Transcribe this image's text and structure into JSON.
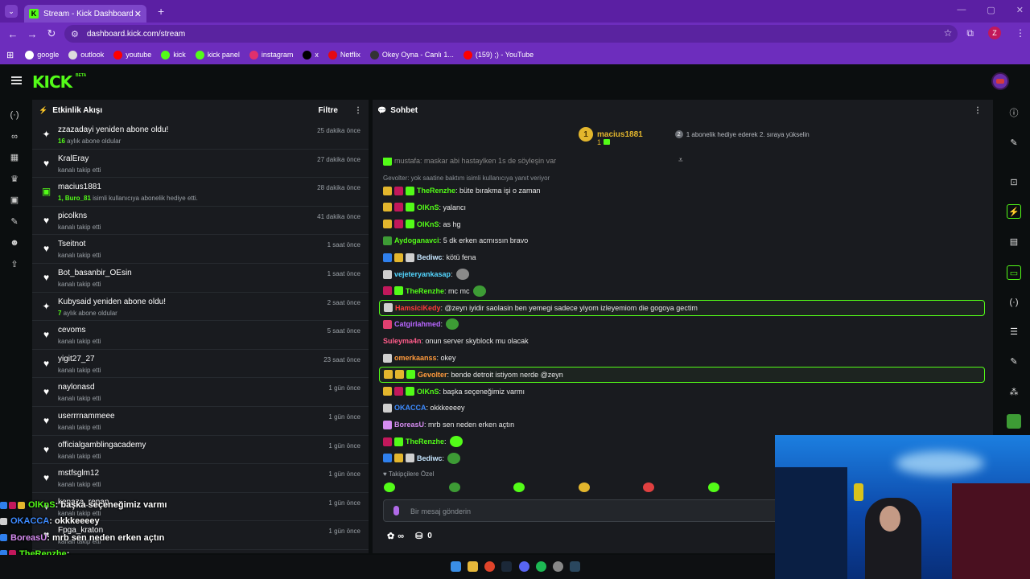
{
  "browser": {
    "tab_title": "Stream - Kick Dashboard",
    "url": "dashboard.kick.com/stream",
    "profile_initial": "Z",
    "bookmarks": [
      {
        "label": "google",
        "icon": "google-icon",
        "color": "#ffffff"
      },
      {
        "label": "outlook",
        "icon": "globe-icon",
        "color": "#dddddd"
      },
      {
        "label": "youtube",
        "icon": "youtube-icon",
        "color": "#ff0000"
      },
      {
        "label": "kick",
        "icon": "kick-icon",
        "color": "#53fc18"
      },
      {
        "label": "kick panel",
        "icon": "kick-icon",
        "color": "#53fc18"
      },
      {
        "label": "instagram",
        "icon": "instagram-icon",
        "color": "#e1306c"
      },
      {
        "label": "x",
        "icon": "x-icon",
        "color": "#000000"
      },
      {
        "label": "Netflix",
        "icon": "netflix-icon",
        "color": "#e50914"
      },
      {
        "label": "Okey Oyna - Canlı 1...",
        "icon": "okey-icon",
        "color": "#333333"
      },
      {
        "label": "(159) ;) - YouTube",
        "icon": "youtube-icon",
        "color": "#ff0000"
      }
    ]
  },
  "kick": {
    "logo": "KICK",
    "beta": "BETA"
  },
  "activity": {
    "title": "Etkinlik Akışı",
    "filter": "Filtre",
    "events": [
      {
        "icon": "sparkle-icon",
        "title": "zzazadayi yeniden abone oldu!",
        "hl": "16",
        "sub": " aylık abone oldular",
        "time": "25 dakika önce"
      },
      {
        "icon": "heart-icon",
        "title": "KralEray",
        "hl": "",
        "sub": "kanalı takip etti",
        "time": "27 dakika önce"
      },
      {
        "icon": "gift-icon",
        "title": "macius1881",
        "hl": "1, Buro_81",
        "sub": " isimli kullanıcıya abonelik hediye etti.",
        "time": "28 dakika önce"
      },
      {
        "icon": "heart-icon",
        "title": "picolkns",
        "hl": "",
        "sub": "kanalı takip etti",
        "time": "41 dakika önce"
      },
      {
        "icon": "heart-icon",
        "title": "Tseitnot",
        "hl": "",
        "sub": "kanalı takip etti",
        "time": "1 saat önce"
      },
      {
        "icon": "heart-icon",
        "title": "Bot_basanbir_OEsin",
        "hl": "",
        "sub": "kanalı takip etti",
        "time": "1 saat önce"
      },
      {
        "icon": "sparkle-icon",
        "title": "Kubysaid yeniden abone oldu!",
        "hl": "7",
        "sub": " aylık abone oldular",
        "time": "2 saat önce"
      },
      {
        "icon": "heart-icon",
        "title": "cevoms",
        "hl": "",
        "sub": "kanalı takip etti",
        "time": "5 saat önce"
      },
      {
        "icon": "heart-icon",
        "title": "yigit27_27",
        "hl": "",
        "sub": "kanalı takip etti",
        "time": "23 saat önce"
      },
      {
        "icon": "heart-icon",
        "title": "naylonasd",
        "hl": "",
        "sub": "kanalı takip etti",
        "time": "1 gün önce"
      },
      {
        "icon": "heart-icon",
        "title": "userrrnammeee",
        "hl": "",
        "sub": "kanalı takip etti",
        "time": "1 gün önce"
      },
      {
        "icon": "heart-icon",
        "title": "officialgamblingacademy",
        "hl": "",
        "sub": "kanalı takip etti",
        "time": "1 gün önce"
      },
      {
        "icon": "heart-icon",
        "title": "mstfsglm12",
        "hl": "",
        "sub": "kanalı takip etti",
        "time": "1 gün önce"
      },
      {
        "icon": "heart-icon",
        "title": "kenaza_renan",
        "hl": "",
        "sub": "kanalı takip etti",
        "time": "1 gün önce"
      },
      {
        "icon": "heart-icon",
        "title": "Fpga_kraton",
        "hl": "",
        "sub": "kanalı takip etti",
        "time": "1 gün önce"
      }
    ]
  },
  "chat": {
    "title": "Sohbet",
    "pinned": {
      "rank": "1",
      "name": "macius1881",
      "count": "1",
      "gift_rank": "2",
      "gift_text": "1 abonelik hediye ederek 2. sıraya yükselin"
    },
    "partial_top": "mustafa: maskar abi hastaylken 1s de söyleşin var",
    "reply": "Gevolter: yok saatine baktım isimli kullanıcıya yanıt veriyor",
    "messages": [
      {
        "badges": [
          "#e3b62d",
          "#c2185b",
          "#53fc18"
        ],
        "user": "TheRenzhe",
        "color": "#53fc18",
        "text": ": büte bırakma işi o zaman",
        "emote": "",
        "hl": false
      },
      {
        "badges": [
          "#e3b62d",
          "#c2185b",
          "#53fc18"
        ],
        "user": "OlKnS",
        "color": "#53fc18",
        "text": ": yalancı",
        "emote": "",
        "hl": false
      },
      {
        "badges": [
          "#e3b62d",
          "#c2185b",
          "#53fc18"
        ],
        "user": "OlKnS",
        "color": "#53fc18",
        "text": ": as hg",
        "emote": "",
        "hl": false
      },
      {
        "badges": [
          "#3d9b35"
        ],
        "user": "Aydoganavci",
        "color": "#53fc18",
        "text": ": 5 dk erken acmıssın bravo",
        "emote": "",
        "hl": false
      },
      {
        "badges": [
          "#2f80ed",
          "#e3b62d",
          "#cfcfcf"
        ],
        "user": "Bediwc",
        "color": "#c6e6ff",
        "text": ": kötü fena",
        "emote": "",
        "hl": false
      },
      {
        "badges": [
          "#cfcfcf"
        ],
        "user": "vejeteryankasap",
        "color": "#53d6ff",
        "text": ": ",
        "emote": "#8a8a8a",
        "hl": false
      },
      {
        "badges": [
          "#c2185b",
          "#53fc18"
        ],
        "user": "TheRenzhe",
        "color": "#53fc18",
        "text": ": mc mc",
        "emote": "#3d9b35",
        "hl": false
      },
      {
        "badges": [
          "#cfcfcf"
        ],
        "user": "HamsiciKedy",
        "color": "#ff3b3b",
        "text": ": @zeyn iyidir saolasin ben yemegi sadece yiyom izleyemiom die gogoya gectim",
        "emote": "",
        "hl": true
      },
      {
        "badges": [
          "#e04070"
        ],
        "user": "Catgirlahmed",
        "color": "#b866ff",
        "text": ": ",
        "emote": "#3d9b35",
        "hl": false
      },
      {
        "badges": [],
        "user": "Suleyma4n",
        "color": "#ff5c8a",
        "text": ": onun server skyblock mu olacak",
        "emote": "",
        "hl": false
      },
      {
        "badges": [
          "#cfcfcf"
        ],
        "user": "omerkaanss",
        "color": "#ff9a3c",
        "text": ": okey",
        "emote": "",
        "hl": false
      },
      {
        "badges": [
          "#e3b62d",
          "#e3b62d",
          "#53fc18"
        ],
        "user": "Gevolter",
        "color": "#ff9a3c",
        "text": ": bende detroit istiyom nerde @zeyn",
        "emote": "",
        "hl": true
      },
      {
        "badges": [
          "#e3b62d",
          "#c2185b",
          "#53fc18"
        ],
        "user": "OlKnS",
        "color": "#53fc18",
        "text": ": başka seçeneğimiz varmı",
        "emote": "",
        "hl": false
      },
      {
        "badges": [
          "#cfcfcf"
        ],
        "user": "OKACCA",
        "color": "#3d8bff",
        "text": ": okkkeeeey",
        "emote": "",
        "hl": false
      },
      {
        "badges": [
          "#d58cf0"
        ],
        "user": "BoreasU",
        "color": "#d58cf0",
        "text": ": mrb sen neden erken açtın",
        "emote": "",
        "hl": false
      },
      {
        "badges": [
          "#c2185b",
          "#53fc18"
        ],
        "user": "TheRenzhe",
        "color": "#53fc18",
        "text": ": ",
        "emote": "#53fc18",
        "hl": false
      },
      {
        "badges": [
          "#2f80ed",
          "#e3b62d",
          "#cfcfcf"
        ],
        "user": "Bediwc",
        "color": "#c6e6ff",
        "text": ": ",
        "emote": "#3d9b35",
        "hl": false
      }
    ],
    "followers_only": "Takipçilere Özel",
    "emote_colors": [
      "#53fc18",
      "#3d9b35",
      "#53fc18",
      "#e3b62d",
      "#e04040",
      "#53fc18"
    ],
    "input_placeholder": "Bir mesaj gönderin",
    "points": "0"
  },
  "overlay": [
    {
      "badges": [
        "#2f80ed",
        "#c2185b",
        "#e3b62d"
      ],
      "user": "OlKnS",
      "color": "#53fc18",
      "text": " : başka seçeneğimiz varmı"
    },
    {
      "badges": [
        "#cfcfcf"
      ],
      "user": "OKACCA",
      "color": "#3d8bff",
      "text": " : okkkeeeey"
    },
    {
      "badges": [
        "#2f80ed"
      ],
      "user": "BoreasU",
      "color": "#d58cf0",
      "text": " : mrb sen neden erken açtın"
    },
    {
      "badges": [
        "#2f80ed",
        "#c2185b"
      ],
      "user": "TheRenzhe",
      "color": "#53fc18",
      "text": " : "
    },
    {
      "badges": [
        "#2f80ed",
        "#e3b62d"
      ],
      "user": "Bediwc",
      "color": "#c6e6ff",
      "text": " : "
    }
  ],
  "colors": {
    "accent": "#53fc18",
    "chrome": "#6d2dbd",
    "panel": "#191b1f"
  }
}
